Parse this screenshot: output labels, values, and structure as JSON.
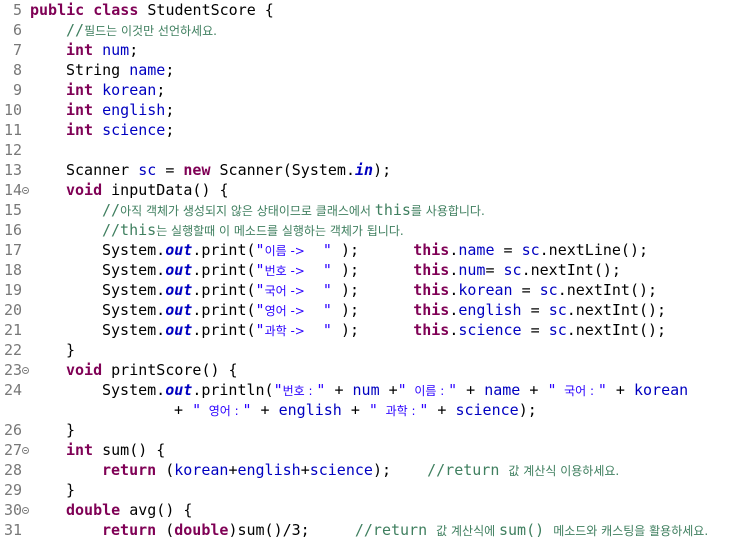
{
  "lines": [
    {
      "n": "5",
      "fold": false,
      "indent": 0,
      "segs": [
        [
          "kw",
          "public"
        ],
        [
          "p",
          " "
        ],
        [
          "kw",
          "class"
        ],
        [
          "p",
          " StudentScore {"
        ]
      ]
    },
    {
      "n": "6",
      "fold": false,
      "indent": 1,
      "segs": [
        [
          "cmt",
          "//"
        ],
        [
          "cmtk",
          "필드는 이것만 선언하세요."
        ]
      ]
    },
    {
      "n": "7",
      "fold": false,
      "indent": 1,
      "segs": [
        [
          "kw",
          "int"
        ],
        [
          "p",
          " "
        ],
        [
          "fld",
          "num"
        ],
        [
          "p",
          ";"
        ]
      ]
    },
    {
      "n": "8",
      "fold": false,
      "indent": 1,
      "segs": [
        [
          "p",
          "String "
        ],
        [
          "fld",
          "name"
        ],
        [
          "p",
          ";"
        ]
      ]
    },
    {
      "n": "9",
      "fold": false,
      "indent": 1,
      "segs": [
        [
          "kw",
          "int"
        ],
        [
          "p",
          " "
        ],
        [
          "fld",
          "korean"
        ],
        [
          "p",
          ";"
        ]
      ]
    },
    {
      "n": "10",
      "fold": false,
      "indent": 1,
      "segs": [
        [
          "kw",
          "int"
        ],
        [
          "p",
          " "
        ],
        [
          "fld",
          "english"
        ],
        [
          "p",
          ";"
        ]
      ]
    },
    {
      "n": "11",
      "fold": false,
      "indent": 1,
      "segs": [
        [
          "kw",
          "int"
        ],
        [
          "p",
          " "
        ],
        [
          "fld",
          "science"
        ],
        [
          "p",
          ";"
        ]
      ]
    },
    {
      "n": "12",
      "fold": false,
      "indent": 0,
      "segs": []
    },
    {
      "n": "13",
      "fold": false,
      "indent": 1,
      "segs": [
        [
          "p",
          "Scanner "
        ],
        [
          "fld",
          "sc"
        ],
        [
          "p",
          " = "
        ],
        [
          "kw",
          "new"
        ],
        [
          "p",
          " Scanner(System."
        ],
        [
          "sfld",
          "in"
        ],
        [
          "p",
          ");"
        ]
      ]
    },
    {
      "n": "14",
      "fold": true,
      "indent": 1,
      "segs": [
        [
          "kw",
          "void"
        ],
        [
          "p",
          " inputData() {"
        ]
      ]
    },
    {
      "n": "15",
      "fold": false,
      "indent": 2,
      "segs": [
        [
          "cmt",
          "//"
        ],
        [
          "cmtk",
          "아직 객체가 생성되지 않은 상태이므로 클래스에서 "
        ],
        [
          "cmt",
          "this"
        ],
        [
          "cmtk",
          "를 사용합니다."
        ]
      ]
    },
    {
      "n": "16",
      "fold": false,
      "indent": 2,
      "segs": [
        [
          "cmt",
          "//this"
        ],
        [
          "cmtk",
          "는 실행할때 이 메소드를 실행하는 객체가 됩니다."
        ]
      ]
    },
    {
      "n": "17",
      "fold": false,
      "indent": 2,
      "segs": [
        [
          "p",
          "System."
        ],
        [
          "sfld",
          "out"
        ],
        [
          "p",
          ".print("
        ],
        [
          "str",
          "\""
        ],
        [
          "strk",
          "이름 ->"
        ],
        [
          "str",
          "  \""
        ],
        [
          "p",
          " );      "
        ],
        [
          "kw",
          "this"
        ],
        [
          "p",
          "."
        ],
        [
          "fld",
          "name"
        ],
        [
          "p",
          " = "
        ],
        [
          "fld",
          "sc"
        ],
        [
          "p",
          ".nextLine();"
        ]
      ]
    },
    {
      "n": "18",
      "fold": false,
      "indent": 2,
      "segs": [
        [
          "p",
          "System."
        ],
        [
          "sfld",
          "out"
        ],
        [
          "p",
          ".print("
        ],
        [
          "str",
          "\""
        ],
        [
          "strk",
          "번호 ->"
        ],
        [
          "str",
          "  \""
        ],
        [
          "p",
          " );      "
        ],
        [
          "kw",
          "this"
        ],
        [
          "p",
          "."
        ],
        [
          "fld",
          "num"
        ],
        [
          "p",
          "= "
        ],
        [
          "fld",
          "sc"
        ],
        [
          "p",
          ".nextInt();"
        ]
      ]
    },
    {
      "n": "19",
      "fold": false,
      "indent": 2,
      "segs": [
        [
          "p",
          "System."
        ],
        [
          "sfld",
          "out"
        ],
        [
          "p",
          ".print("
        ],
        [
          "str",
          "\""
        ],
        [
          "strk",
          "국어 ->"
        ],
        [
          "str",
          "  \""
        ],
        [
          "p",
          " );      "
        ],
        [
          "kw",
          "this"
        ],
        [
          "p",
          "."
        ],
        [
          "fld",
          "korean"
        ],
        [
          "p",
          " = "
        ],
        [
          "fld",
          "sc"
        ],
        [
          "p",
          ".nextInt();"
        ]
      ]
    },
    {
      "n": "20",
      "fold": false,
      "indent": 2,
      "segs": [
        [
          "p",
          "System."
        ],
        [
          "sfld",
          "out"
        ],
        [
          "p",
          ".print("
        ],
        [
          "str",
          "\""
        ],
        [
          "strk",
          "영어 ->"
        ],
        [
          "str",
          "  \""
        ],
        [
          "p",
          " );      "
        ],
        [
          "kw",
          "this"
        ],
        [
          "p",
          "."
        ],
        [
          "fld",
          "english"
        ],
        [
          "p",
          " = "
        ],
        [
          "fld",
          "sc"
        ],
        [
          "p",
          ".nextInt();"
        ]
      ]
    },
    {
      "n": "21",
      "fold": false,
      "indent": 2,
      "segs": [
        [
          "p",
          "System."
        ],
        [
          "sfld",
          "out"
        ],
        [
          "p",
          ".print("
        ],
        [
          "str",
          "\""
        ],
        [
          "strk",
          "과학 ->"
        ],
        [
          "str",
          "  \""
        ],
        [
          "p",
          " );      "
        ],
        [
          "kw",
          "this"
        ],
        [
          "p",
          "."
        ],
        [
          "fld",
          "science"
        ],
        [
          "p",
          " = "
        ],
        [
          "fld",
          "sc"
        ],
        [
          "p",
          ".nextInt();"
        ]
      ]
    },
    {
      "n": "22",
      "fold": false,
      "indent": 1,
      "segs": [
        [
          "p",
          "}"
        ]
      ]
    },
    {
      "n": "23",
      "fold": true,
      "indent": 1,
      "segs": [
        [
          "kw",
          "void"
        ],
        [
          "p",
          " printScore() {"
        ]
      ]
    },
    {
      "n": "24",
      "fold": false,
      "indent": 2,
      "segs": [
        [
          "p",
          "System."
        ],
        [
          "sfld",
          "out"
        ],
        [
          "p",
          ".println("
        ],
        [
          "str",
          "\""
        ],
        [
          "strk",
          "번호 : "
        ],
        [
          "str",
          "\""
        ],
        [
          "p",
          " + "
        ],
        [
          "fld",
          "num"
        ],
        [
          "p",
          " +"
        ],
        [
          "str",
          "\""
        ],
        [
          "strk",
          "  이름 : "
        ],
        [
          "str",
          "\""
        ],
        [
          "p",
          " + "
        ],
        [
          "fld",
          "name"
        ],
        [
          "p",
          " + "
        ],
        [
          "str",
          "\""
        ],
        [
          "strk",
          "  국어 : "
        ],
        [
          "str",
          "\""
        ],
        [
          "p",
          " + "
        ],
        [
          "fld",
          "korean"
        ]
      ]
    },
    {
      "n": "",
      "fold": false,
      "indent": 4,
      "segs": [
        [
          "p",
          "+ "
        ],
        [
          "str",
          "\""
        ],
        [
          "strk",
          "  영어 : "
        ],
        [
          "str",
          "\""
        ],
        [
          "p",
          " + "
        ],
        [
          "fld",
          "english"
        ],
        [
          "p",
          " + "
        ],
        [
          "str",
          "\""
        ],
        [
          "strk",
          "  과학 : "
        ],
        [
          "str",
          "\""
        ],
        [
          "p",
          " + "
        ],
        [
          "fld",
          "science"
        ],
        [
          "p",
          ");"
        ]
      ]
    },
    {
      "n": "26",
      "fold": false,
      "indent": 1,
      "segs": [
        [
          "p",
          "}"
        ]
      ]
    },
    {
      "n": "27",
      "fold": true,
      "indent": 1,
      "segs": [
        [
          "kw",
          "int"
        ],
        [
          "p",
          " sum() {"
        ]
      ]
    },
    {
      "n": "28",
      "fold": false,
      "indent": 2,
      "segs": [
        [
          "kw",
          "return"
        ],
        [
          "p",
          " ("
        ],
        [
          "fld",
          "korean"
        ],
        [
          "p",
          "+"
        ],
        [
          "fld",
          "english"
        ],
        [
          "p",
          "+"
        ],
        [
          "fld",
          "science"
        ],
        [
          "p",
          ");    "
        ],
        [
          "cmt",
          "//return "
        ],
        [
          "cmtk",
          "값 계산식 이용하세요."
        ]
      ]
    },
    {
      "n": "29",
      "fold": false,
      "indent": 1,
      "segs": [
        [
          "p",
          "}"
        ]
      ]
    },
    {
      "n": "30",
      "fold": true,
      "indent": 1,
      "segs": [
        [
          "kw",
          "double"
        ],
        [
          "p",
          " avg() {"
        ]
      ]
    },
    {
      "n": "31",
      "fold": false,
      "indent": 2,
      "segs": [
        [
          "kw",
          "return"
        ],
        [
          "p",
          " ("
        ],
        [
          "kw",
          "double"
        ],
        [
          "p",
          ")sum()/3;     "
        ],
        [
          "cmt",
          "//return "
        ],
        [
          "cmtk",
          "값 계산식에 "
        ],
        [
          "cmt",
          "sum() "
        ],
        [
          "cmtk",
          "메소드와 캐스팅을 활용하세요."
        ]
      ]
    }
  ]
}
